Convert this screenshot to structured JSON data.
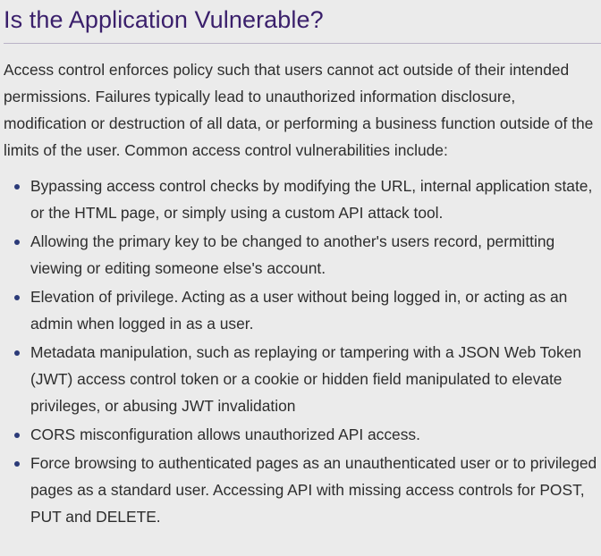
{
  "heading": "Is the Application Vulnerable?",
  "intro": "Access control enforces policy such that users cannot act outside of their intended permissions. Failures typically lead to unauthorized information disclosure, modification or destruction of all data, or performing a business function outside of the limits of the user. Common access control vulnerabilities include:",
  "items": [
    {
      "text": "Bypassing access control checks by modifying the URL, internal application state, or the HTML page, or simply using a custom API attack tool."
    },
    {
      "text": "Allowing the primary key to be changed to another's users record, permitting viewing or editing someone else's account."
    },
    {
      "text": "Elevation of privilege. Acting as a user without being logged in, or acting as an admin when logged in as a user."
    },
    {
      "text": "Metadata manipulation, such as replaying or tampering with a JSON Web Token (JWT) access control token or a cookie or hidden field manipulated to elevate privileges, or abusing JWT invalidation"
    },
    {
      "text": "CORS misconfiguration allows unauthorized API access."
    },
    {
      "text": "Force browsing to authenticated pages as an unauthenticated user or to privileged pages as a standard user. Accessing API with missing access controls for POST, PUT and DELETE."
    }
  ],
  "colors": {
    "heading": "#3a1f6b",
    "bullet": "#2b3a78",
    "text": "#2d2d2d",
    "background": "#ebebeb"
  }
}
